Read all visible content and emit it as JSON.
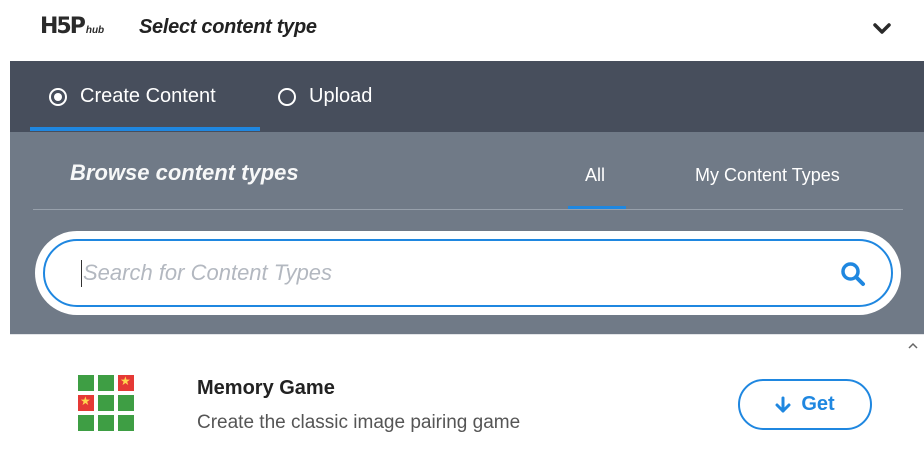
{
  "header": {
    "logo_main": "H5P",
    "logo_sub": "hub",
    "title": "Select content type",
    "toggle_icon": "chevron-down-icon"
  },
  "tabs": [
    {
      "label": "Create Content",
      "selected": true
    },
    {
      "label": "Upload",
      "selected": false
    }
  ],
  "browse": {
    "title": "Browse content types",
    "filters": [
      {
        "label": "All",
        "active": true
      },
      {
        "label": "My Content Types",
        "active": false
      }
    ]
  },
  "search": {
    "placeholder": "Search for Content Types",
    "value": "",
    "icon": "search-icon"
  },
  "content_types": [
    {
      "name": "Memory Game",
      "description": "Create the classic image pairing game",
      "action_label": "Get",
      "icon": "memory-game-icon"
    }
  ],
  "colors": {
    "accent": "#1f87e0",
    "tabbar_bg": "#474e5c",
    "browse_bg": "#707a87"
  }
}
